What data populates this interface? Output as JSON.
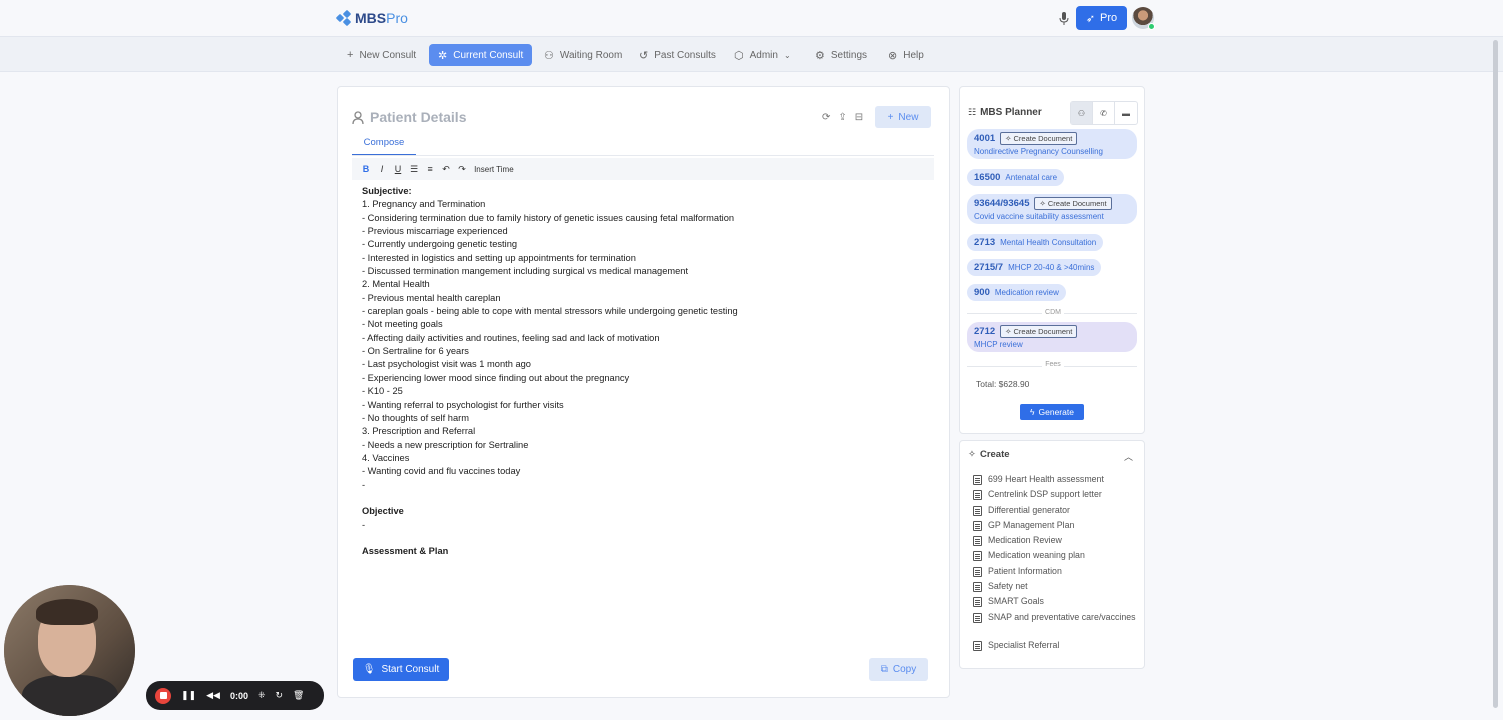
{
  "app": {
    "name_main": "MBS",
    "name_accent": "Pro"
  },
  "header": {
    "pro_label": "Pro"
  },
  "nav": [
    {
      "label": "New Consult",
      "icon": "plus-icon"
    },
    {
      "label": "Current Consult",
      "icon": "gear-icon",
      "active": true
    },
    {
      "label": "Waiting Room",
      "icon": "users-icon"
    },
    {
      "label": "Past Consults",
      "icon": "history-icon"
    },
    {
      "label": "Admin",
      "icon": "box-icon"
    },
    {
      "label": "Settings",
      "icon": "settings-icon"
    },
    {
      "label": "Help",
      "icon": "help-icon"
    }
  ],
  "patient": {
    "title": "Patient Details",
    "new_label": "New",
    "tab": "Compose",
    "insert_time": "Insert Time",
    "start_label": "Start Consult",
    "copy_label": "Copy"
  },
  "note": [
    {
      "text": "Subjective:",
      "bold": true
    },
    {
      "text": "1. Pregnancy and Termination"
    },
    {
      "text": " - Considering termination due to family history of genetic issues causing fetal malformation"
    },
    {
      "text": " - Previous miscarriage experienced"
    },
    {
      "text": " - Currently undergoing genetic testing"
    },
    {
      "text": " - Interested in logistics and setting up appointments for termination"
    },
    {
      "text": " - Discussed termination mangement including surgical vs medical management"
    },
    {
      "text": "2. Mental Health"
    },
    {
      "text": " - Previous mental health careplan"
    },
    {
      "text": " - careplan goals - being able to cope with mental stressors while undergoing genetic testing"
    },
    {
      "text": " - Not meeting goals"
    },
    {
      "text": " - Affecting daily activities and routines, feeling sad and lack of motivation"
    },
    {
      "text": " - On Sertraline for 6 years"
    },
    {
      "text": " - Last psychologist visit was 1 month ago"
    },
    {
      "text": " - Experiencing lower mood since finding out about the pregnancy"
    },
    {
      "text": " - K10 - 25"
    },
    {
      "text": " - Wanting referral to psychologist for further visits"
    },
    {
      "text": " - No thoughts of self harm"
    },
    {
      "text": "3. Prescription and Referral"
    },
    {
      "text": " - Needs a new prescription for Sertraline"
    },
    {
      "text": "4. Vaccines"
    },
    {
      "text": " - Wanting covid and flu vaccines today"
    },
    {
      "text": " -"
    },
    {
      "text": ""
    },
    {
      "text": "Objective",
      "bold": true
    },
    {
      "text": " -"
    },
    {
      "text": ""
    },
    {
      "text": "Assessment & Plan",
      "bold": true
    }
  ],
  "planner": {
    "title": "MBS Planner",
    "create_doc": "Create Document",
    "items": [
      {
        "code": "4001",
        "desc": "Nondirective Pregnancy Counselling",
        "doc": true
      },
      {
        "code": "16500",
        "desc": "Antenatal care"
      },
      {
        "code": "93644/93645",
        "desc": "Covid vaccine suitability assessment",
        "doc": true
      },
      {
        "code": "2713",
        "desc": "Mental Health Consultation"
      },
      {
        "code": "2715/7",
        "desc": "MHCP 20-40 & >40mins"
      },
      {
        "code": "900",
        "desc": "Medication review"
      }
    ],
    "cdm_label": "CDM",
    "cdm_item": {
      "code": "2712",
      "desc": "MHCP review",
      "doc": true
    },
    "fees_label": "Fees",
    "total": "Total: $628.90",
    "generate_label": "Generate"
  },
  "create": {
    "title": "Create",
    "items": [
      "699 Heart Health assessment",
      "Centrelink DSP support letter",
      "Differential generator",
      "GP Management Plan",
      "Medication Review",
      "Medication weaning plan",
      "Patient Information",
      "Safety net",
      "SMART Goals",
      "SNAP and preventative care/vaccines",
      "Specialist Referral"
    ]
  },
  "recorder": {
    "time": "0:00"
  },
  "colors": {
    "primary": "#2f6ee8",
    "pill": "#dde6fb",
    "pill_cdm": "#e3e0f7"
  }
}
